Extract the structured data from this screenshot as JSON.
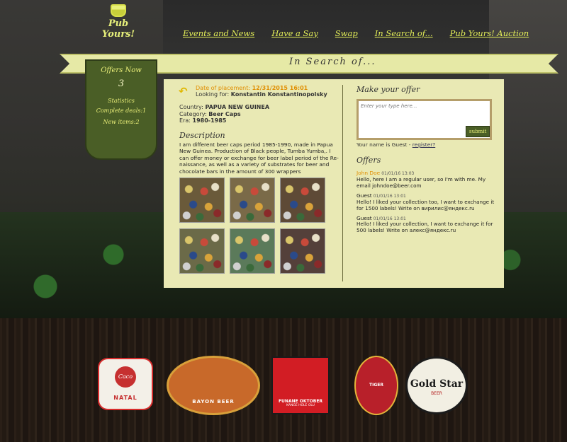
{
  "brand": {
    "logo_text": "Pub Yours!"
  },
  "nav": {
    "items": [
      "Events and News",
      "Have a Say",
      "Swap",
      "In Search of...",
      "Pub Yours! Auction"
    ]
  },
  "ribbon": {
    "title": "In Search of..."
  },
  "sidebar": {
    "offers_label": "Offers Now",
    "offers_count": "3",
    "statistics_label": "Statistics",
    "complete_deals": "Complete deals:1",
    "new_items": "New items:2"
  },
  "listing": {
    "placement_label": "Date of placement:",
    "placement_value": "12/31/2015 16:01",
    "looking_label": "Looking for:",
    "looking_value": "Konstantin Konstantinopolsky",
    "country_label": "Country:",
    "country_value": "PAPUA NEW GUINEA",
    "category_label": "Category:",
    "category_value": "Beer Caps",
    "era_label": "Era:",
    "era_value": "1980-1985",
    "description_heading": "Description",
    "description": "I am different beer caps period 1985-1990, made in Papua New Guinea. Production of Black people, Tumba Yumba,. I can offer money or exchange for beer label period of the Re-naissance, as well as a variety of substrates for beer and chocolate bars in the amount of 300 wrappers",
    "thumb_colors": [
      "#6a5a3a",
      "#7a6a48",
      "#5e4a36",
      "#6b6a48",
      "#5b7a5a",
      "#54403a"
    ]
  },
  "offer_form": {
    "heading": "Make your offer",
    "placeholder": "Enter your type here...",
    "submit_label": "submit",
    "guest_text": "Your name is Guest -",
    "register_link": "register?"
  },
  "offers": {
    "heading": "Offers",
    "items": [
      {
        "who": "John Doe",
        "date": "01/01/16 13:03",
        "text": "Hello, here I am a regular user, so I'm with me. My email johndoe@beer.com"
      },
      {
        "who": "Guest",
        "date": "01/01/16 13:01",
        "text": "Hello! I liked your collection too, I want to exchange it for 1500 labels! Write on вирилис@яндекс.ru"
      },
      {
        "who": "Guest",
        "date": "01/01/16 13:01",
        "text": "Hello! I liked your collection, I want to exchange it for 500 labels! Write on алекс@яндекс.ru"
      }
    ]
  },
  "footer_labels": {
    "l1": "NATAL",
    "l1_badge": "Caco",
    "l2": "BAYON BEER",
    "l3": "FUNANE OKTOBER",
    "l3_sub": "KANGE HOLE OLU",
    "l4": "TIGER",
    "l5": "Gold Star",
    "l5_sub": "BEER"
  }
}
